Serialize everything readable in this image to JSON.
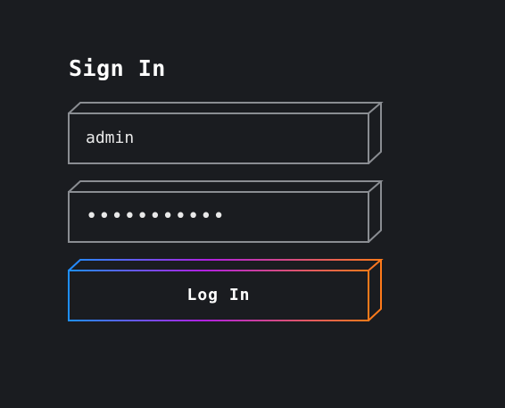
{
  "form": {
    "title": "Sign In",
    "username": {
      "value": "admin"
    },
    "password": {
      "value": "•••••••••••"
    },
    "login_button": {
      "label": "Log In"
    }
  },
  "colors": {
    "background": "#1a1c20",
    "field_border": "#8a8d92",
    "button_gradient_start": "#1e8fff",
    "button_gradient_mid": "#b020e0",
    "button_gradient_end": "#ff7a1a"
  }
}
